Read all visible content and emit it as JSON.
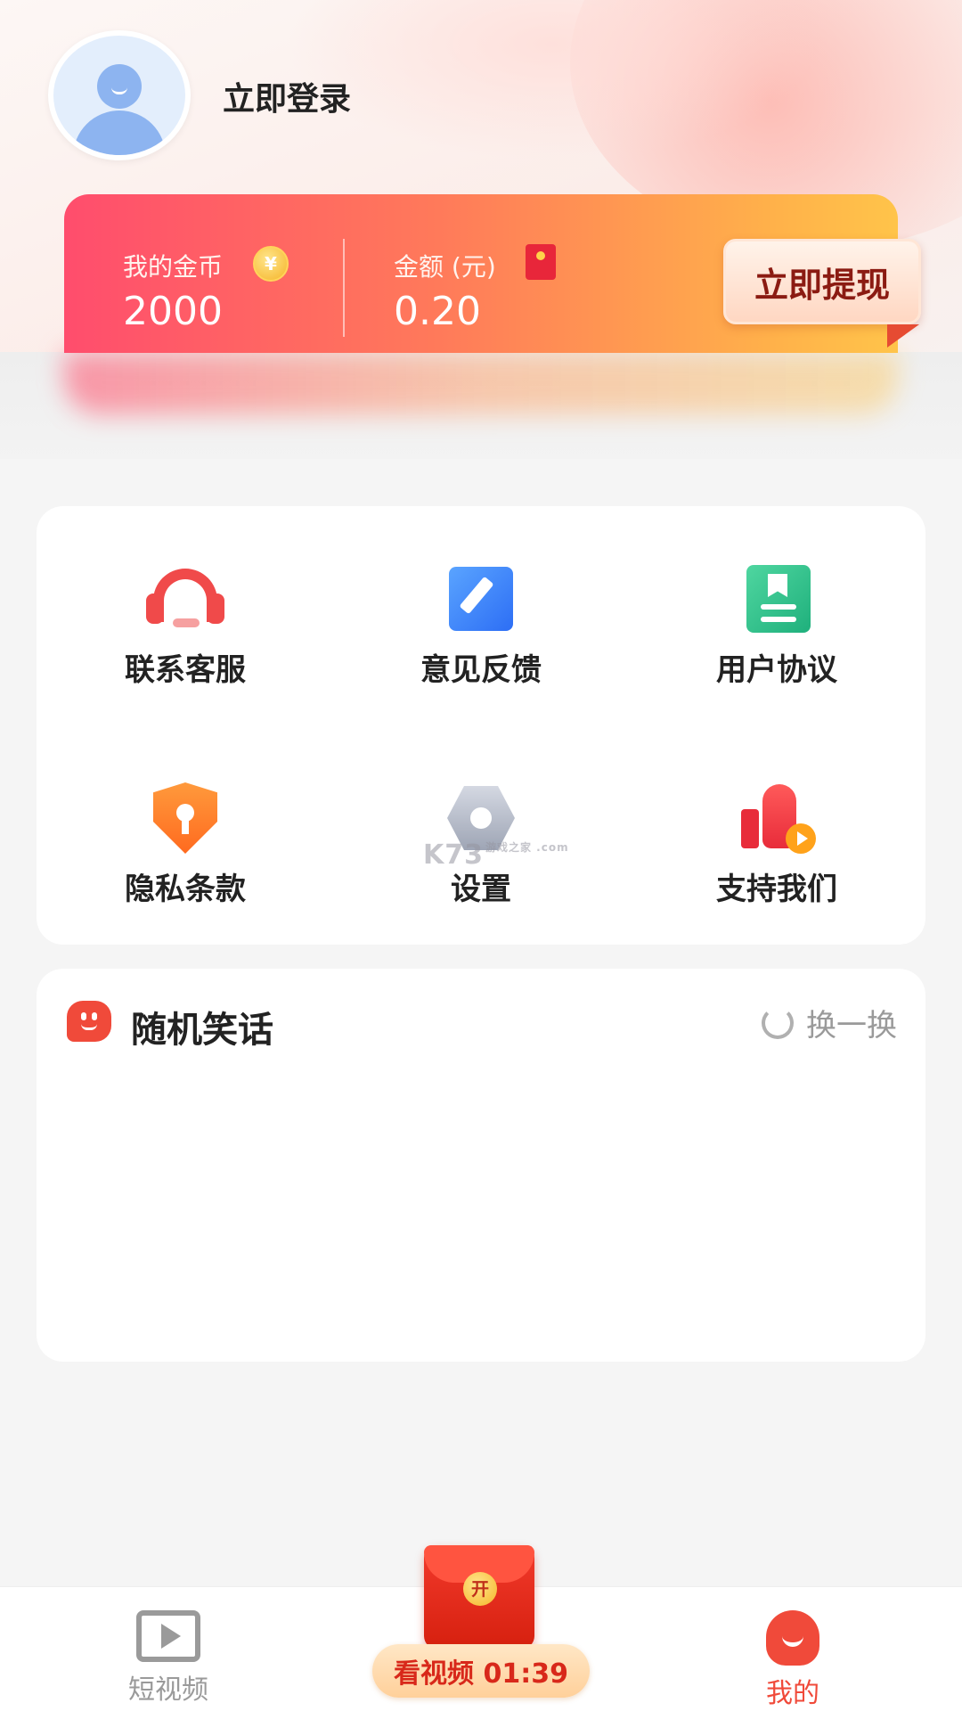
{
  "header": {
    "login_label": "立即登录"
  },
  "wallet": {
    "coins_label": "我的金币",
    "coins_value": "2000",
    "coin_icon_glyph": "¥",
    "amount_label": "金额 (元)",
    "amount_value": "0.20",
    "withdraw_label": "立即提现"
  },
  "menu": {
    "items": [
      {
        "label": "联系客服",
        "icon": "headset-icon"
      },
      {
        "label": "意见反馈",
        "icon": "edit-icon"
      },
      {
        "label": "用户协议",
        "icon": "document-icon"
      },
      {
        "label": "隐私条款",
        "icon": "shield-lock-icon"
      },
      {
        "label": "设置",
        "icon": "settings-icon"
      },
      {
        "label": "支持我们",
        "icon": "thumbs-up-icon"
      }
    ]
  },
  "watermark": {
    "text": "K73",
    "sub": "游戏之家 .com"
  },
  "joke": {
    "title": "随机笑话",
    "refresh_label": "换一换"
  },
  "tabbar": {
    "tab_video": "短视频",
    "tab_mine": "我的",
    "redpack_seal": "开",
    "timer_label": "看视频 01:39"
  },
  "colors": {
    "accent": "#f04a3a",
    "tab_inactive": "#9a9a9a"
  }
}
